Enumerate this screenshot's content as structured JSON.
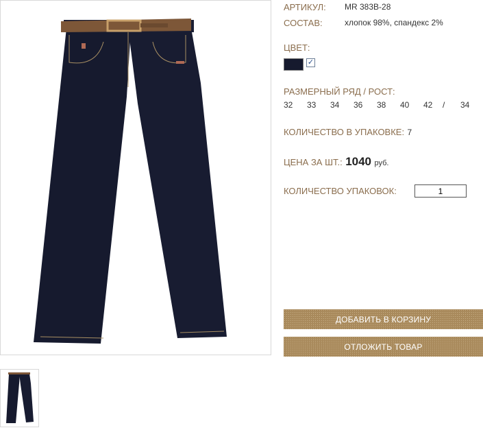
{
  "product": {
    "article_label": "АРТИКУЛ:",
    "article_value": "MR 383B-28",
    "composition_label": "СОСТАВ:",
    "composition_value": "хлопок 98%, спандекс 2%",
    "color_label": "ЦВЕТ:",
    "color_swatch": "#161a2e",
    "color_checked": "✓",
    "sizes_label": "РАЗМЕРНЫЙ РЯД / РОСТ:",
    "sizes": [
      "32",
      "33",
      "34",
      "36",
      "38",
      "40",
      "42",
      "/",
      "34"
    ],
    "pack_qty_label": "КОЛИЧЕСТВО В УПАКОВКЕ:",
    "pack_qty_value": "7",
    "price_label": "ЦЕНА ЗА ШТ.:",
    "price_value": "1040",
    "price_currency": "руб.",
    "packs_label": "КОЛИЧЕСТВО УПАКОВОК:",
    "packs_value": "1"
  },
  "buttons": {
    "add_to_cart": "ДОБАВИТЬ В КОРЗИНУ",
    "postpone": "ОТЛОЖИТЬ ТОВАР"
  },
  "images": {
    "main": "jeans-photo",
    "thumbnail": "jeans-thumbnail"
  },
  "colors": {
    "label": "#8a6d4d",
    "button": "#a98a5c",
    "denim": "#161a2e",
    "belt": "#7d5738"
  }
}
